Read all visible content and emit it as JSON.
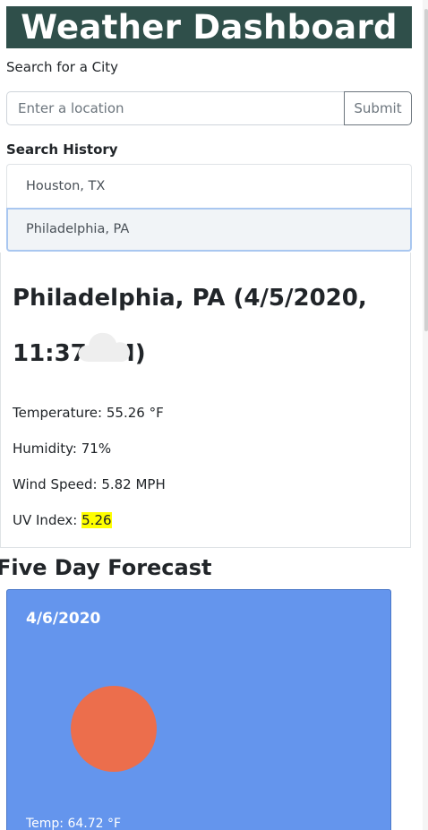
{
  "header": {
    "title": "Weather Dashboard"
  },
  "search": {
    "label": "Search for a City",
    "placeholder": "Enter a location",
    "value": "",
    "submit_label": "Submit"
  },
  "history": {
    "label": "Search History",
    "items": [
      {
        "label": "Houston, TX",
        "active": false
      },
      {
        "label": "Philadelphia, PA",
        "active": true
      }
    ]
  },
  "current": {
    "title": "Philadelphia, PA (4/5/2020, 11:37 PM)",
    "icon": "cloud-icon",
    "temperature_label": "Temperature:",
    "temperature_value": "55.26 °F",
    "humidity_label": "Humidity:",
    "humidity_value": "71%",
    "wind_label": "Wind Speed:",
    "wind_value": "5.82 MPH",
    "uv_label": "UV Index:",
    "uv_value": "5.26",
    "uv_highlight_color": "#ffff00"
  },
  "forecast": {
    "title": "Five Day Forecast",
    "days": [
      {
        "date": "4/6/2020",
        "icon": "sun-icon",
        "temp_label": "Temp:",
        "temp_value": "64.72 °F",
        "card_color": "#6495ed"
      }
    ]
  },
  "colors": {
    "header_bg": "#2f4f4a",
    "forecast_card_bg": "#6495ed",
    "sun_color": "#ec6e4c"
  }
}
